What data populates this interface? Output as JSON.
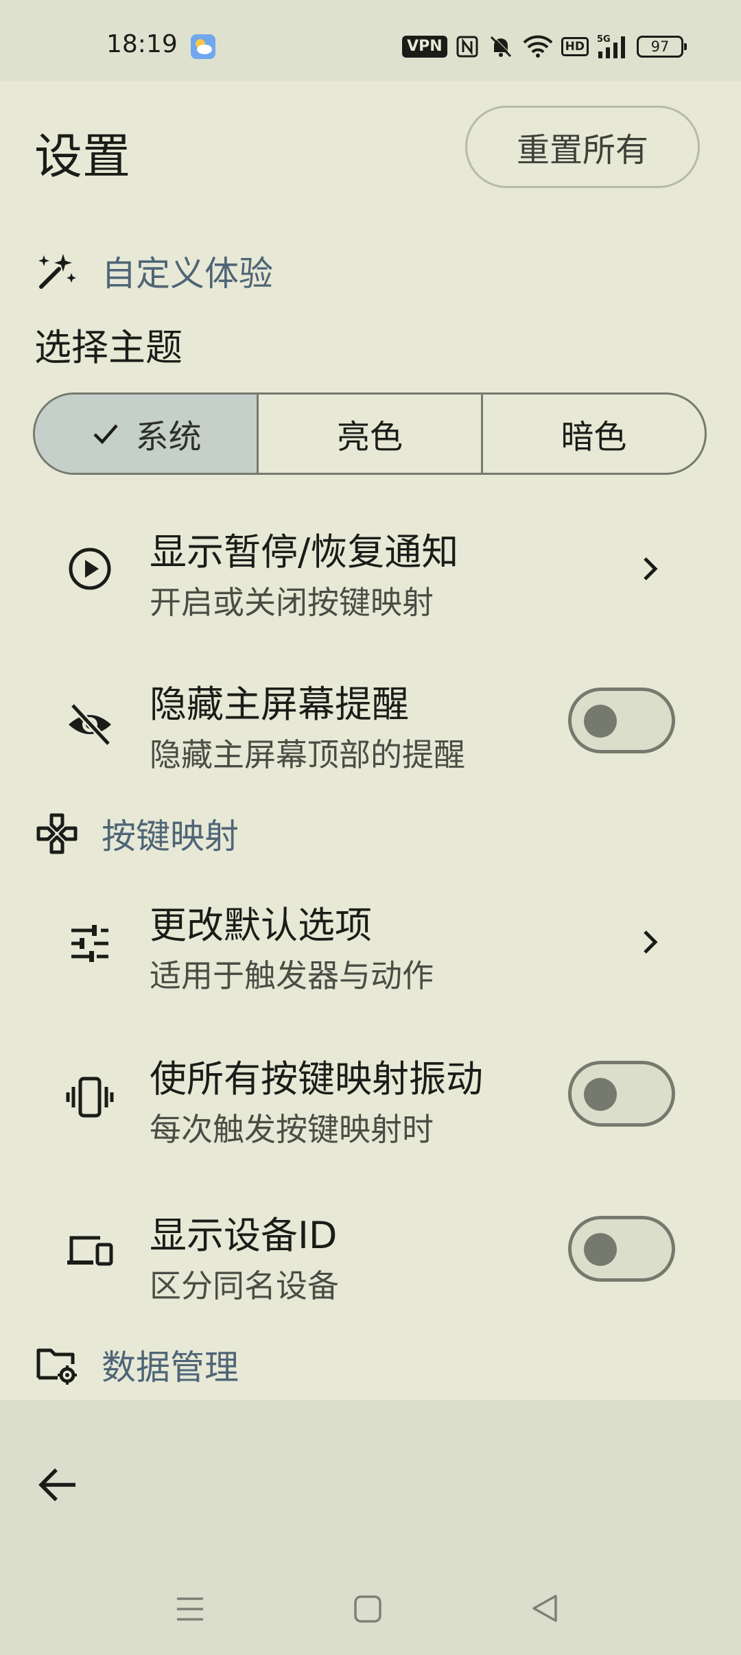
{
  "status_bar": {
    "time": "18:19",
    "vpn": "VPN",
    "hd": "HD",
    "network": "5G",
    "battery": "97"
  },
  "header": {
    "title": "设置",
    "reset_label": "重置所有"
  },
  "sections": {
    "customize": {
      "label": "自定义体验",
      "icon": "magic-wand-icon"
    },
    "keymaps": {
      "label": "按键映射",
      "icon": "gamepad-icon"
    },
    "data": {
      "label": "数据管理",
      "icon": "folder-settings-icon"
    }
  },
  "theme": {
    "label": "选择主题",
    "options": [
      "系统",
      "亮色",
      "暗色"
    ],
    "selected": "系统"
  },
  "rows": [
    {
      "title": "显示暂停/恢复通知",
      "subtitle": "开启或关闭按键映射",
      "icon": "play-circle-icon",
      "control": "chevron"
    },
    {
      "title": "隐藏主屏幕提醒",
      "subtitle": "隐藏主屏幕顶部的提醒",
      "icon": "eye-off-icon",
      "control": "toggle",
      "on": false
    },
    {
      "title": "更改默认选项",
      "subtitle": "适用于触发器与动作",
      "icon": "tune-icon",
      "control": "chevron"
    },
    {
      "title": "使所有按键映射振动",
      "subtitle": "每次触发按键映射时",
      "icon": "vibrate-icon",
      "control": "toggle",
      "on": false
    },
    {
      "title": "显示设备ID",
      "subtitle": "区分同名设备",
      "icon": "devices-icon",
      "control": "toggle",
      "on": false
    }
  ],
  "colors": {
    "background": "#e7e9d6",
    "accent_text": "#4f6577",
    "selected_segment": "#c6d0cb",
    "outline": "#76796d"
  }
}
